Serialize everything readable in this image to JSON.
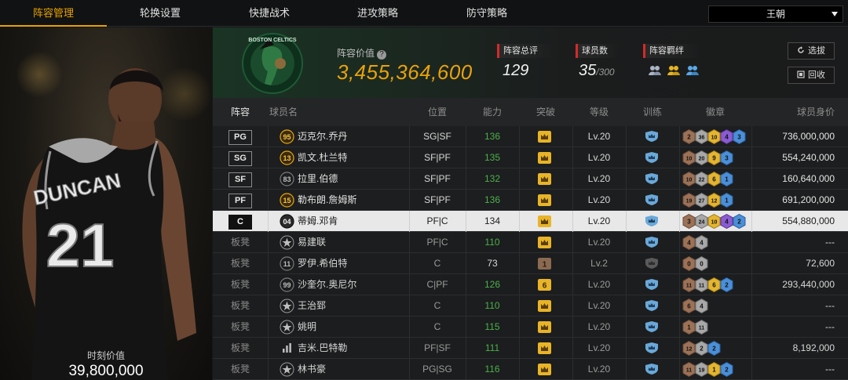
{
  "nav": {
    "tabs": [
      {
        "label": "阵容管理",
        "active": true
      },
      {
        "label": "轮换设置",
        "active": false
      },
      {
        "label": "快捷战术",
        "active": false
      },
      {
        "label": "进攻策略",
        "active": false
      },
      {
        "label": "防守策略",
        "active": false
      }
    ],
    "team_select": "王朝"
  },
  "player_panel": {
    "jersey_name": "DUNCAN",
    "jersey_number": "21",
    "value_label": "时刻价值",
    "value": "39,800,000"
  },
  "summary": {
    "team_logo_text": "BOSTON CELTICS",
    "lineup_value_label": "阵容价值",
    "lineup_value": "3,455,364,600",
    "total_rating_label": "阵容总评",
    "total_rating": "129",
    "player_count_label": "球员数",
    "player_count": "35",
    "player_count_max": "/300",
    "bond_label": "阵容羁绊",
    "select_button": "选拔",
    "recycle_button": "回收"
  },
  "colors": {
    "accent": "#e8a100",
    "potential_green": "#4bb14b",
    "value_gold": "#e8a20a",
    "tag_red": "#d42a2a"
  },
  "table": {
    "headers": {
      "lineup": "阵容",
      "name": "球员名",
      "position": "位置",
      "ability": "能力",
      "breakthrough": "突破",
      "level": "等级",
      "training": "训练",
      "badges": "徽章",
      "value": "球员身价"
    },
    "rows": [
      {
        "slot": "PG",
        "bench": false,
        "rank": "95",
        "rank_style": "gold",
        "name": "迈克尔.乔丹",
        "position": "SG|SF",
        "ability": "136",
        "ability_green": true,
        "breakthrough": "crown-gold",
        "level": "Lv.20",
        "training": "blue",
        "badges": [
          {
            "v": "2",
            "c": "bronze"
          },
          {
            "v": "36",
            "c": "silver"
          },
          {
            "v": "10",
            "c": "gold"
          },
          {
            "v": "4",
            "c": "purple"
          },
          {
            "v": "3",
            "c": "blue"
          }
        ],
        "value": "736,000,000",
        "selected": false
      },
      {
        "slot": "SG",
        "bench": false,
        "rank": "13",
        "rank_style": "gold",
        "name": "凯文.杜兰特",
        "position": "SF|PF",
        "ability": "135",
        "ability_green": true,
        "breakthrough": "crown-gold",
        "level": "Lv.20",
        "training": "blue",
        "badges": [
          {
            "v": "10",
            "c": "bronze"
          },
          {
            "v": "20",
            "c": "silver"
          },
          {
            "v": "9",
            "c": "gold"
          },
          {
            "v": "3",
            "c": "blue"
          }
        ],
        "value": "554,240,000",
        "selected": false
      },
      {
        "slot": "SF",
        "bench": false,
        "rank": "83",
        "rank_style": "plain",
        "name": "拉里.伯德",
        "position": "SF|PF",
        "ability": "132",
        "ability_green": true,
        "breakthrough": "crown-gold",
        "level": "Lv.20",
        "training": "blue",
        "badges": [
          {
            "v": "10",
            "c": "bronze"
          },
          {
            "v": "22",
            "c": "silver"
          },
          {
            "v": "6",
            "c": "gold"
          },
          {
            "v": "1",
            "c": "blue"
          }
        ],
        "value": "160,640,000",
        "selected": false
      },
      {
        "slot": "PF",
        "bench": false,
        "rank": "15",
        "rank_style": "gold",
        "name": "勒布朗.詹姆斯",
        "position": "SF|PF",
        "ability": "136",
        "ability_green": true,
        "breakthrough": "crown-gold",
        "level": "Lv.20",
        "training": "blue",
        "badges": [
          {
            "v": "19",
            "c": "bronze"
          },
          {
            "v": "27",
            "c": "silver"
          },
          {
            "v": "12",
            "c": "gold"
          },
          {
            "v": "1",
            "c": "blue"
          }
        ],
        "value": "691,200,000",
        "selected": false
      },
      {
        "slot": "C",
        "bench": false,
        "rank": "04",
        "rank_style": "dark",
        "name": "蒂姆.邓肯",
        "position": "PF|C",
        "ability": "134",
        "ability_green": false,
        "breakthrough": "crown-gold",
        "level": "Lv.20",
        "training": "blue",
        "badges": [
          {
            "v": "3",
            "c": "bronze"
          },
          {
            "v": "24",
            "c": "silver"
          },
          {
            "v": "10",
            "c": "gold"
          },
          {
            "v": "4",
            "c": "purple"
          },
          {
            "v": "2",
            "c": "blue"
          }
        ],
        "value": "554,880,000",
        "selected": true
      },
      {
        "slot": "板凳",
        "bench": true,
        "rank": "",
        "rank_style": "star",
        "name": "易建联",
        "position": "PF|C",
        "ability": "110",
        "ability_green": true,
        "breakthrough": "crown-gold",
        "level": "Lv.20",
        "training": "blue",
        "badges": [
          {
            "v": "4",
            "c": "bronze"
          },
          {
            "v": "4",
            "c": "silver"
          }
        ],
        "value": "---",
        "selected": false
      },
      {
        "slot": "板凳",
        "bench": true,
        "rank": "11",
        "rank_style": "plain",
        "name": "罗伊.希伯特",
        "position": "C",
        "ability": "73",
        "ability_green": false,
        "breakthrough": "num-1",
        "level": "Lv.2",
        "training": "grey",
        "badges": [
          {
            "v": "0",
            "c": "bronze"
          },
          {
            "v": "0",
            "c": "silver"
          }
        ],
        "value": "72,600",
        "selected": false
      },
      {
        "slot": "板凳",
        "bench": true,
        "rank": "99",
        "rank_style": "plain",
        "name": "沙奎尔.奥尼尔",
        "position": "C|PF",
        "ability": "126",
        "ability_green": true,
        "breakthrough": "num-6",
        "level": "Lv.20",
        "training": "blue",
        "badges": [
          {
            "v": "11",
            "c": "bronze"
          },
          {
            "v": "11",
            "c": "silver"
          },
          {
            "v": "6",
            "c": "gold"
          },
          {
            "v": "2",
            "c": "blue"
          }
        ],
        "value": "293,440,000",
        "selected": false
      },
      {
        "slot": "板凳",
        "bench": true,
        "rank": "",
        "rank_style": "star",
        "name": "王治郅",
        "position": "C",
        "ability": "110",
        "ability_green": true,
        "breakthrough": "crown-gold",
        "level": "Lv.20",
        "training": "blue",
        "badges": [
          {
            "v": "6",
            "c": "bronze"
          },
          {
            "v": "4",
            "c": "silver"
          }
        ],
        "value": "---",
        "selected": false
      },
      {
        "slot": "板凳",
        "bench": true,
        "rank": "",
        "rank_style": "star",
        "name": "姚明",
        "position": "C",
        "ability": "115",
        "ability_green": true,
        "breakthrough": "crown-gold",
        "level": "Lv.20",
        "training": "blue",
        "badges": [
          {
            "v": "1",
            "c": "bronze"
          },
          {
            "v": "11",
            "c": "silver"
          }
        ],
        "value": "---",
        "selected": false
      },
      {
        "slot": "板凳",
        "bench": true,
        "rank": "",
        "rank_style": "bars",
        "name": "吉米.巴特勒",
        "position": "PF|SF",
        "ability": "111",
        "ability_green": true,
        "breakthrough": "crown-gold",
        "level": "Lv.20",
        "training": "blue",
        "badges": [
          {
            "v": "12",
            "c": "bronze"
          },
          {
            "v": "2",
            "c": "silver"
          },
          {
            "v": "2",
            "c": "blue"
          }
        ],
        "value": "8,192,000",
        "selected": false
      },
      {
        "slot": "板凳",
        "bench": true,
        "rank": "",
        "rank_style": "star",
        "name": "林书豪",
        "position": "PG|SG",
        "ability": "116",
        "ability_green": true,
        "breakthrough": "crown-gold",
        "level": "Lv.20",
        "training": "blue",
        "badges": [
          {
            "v": "11",
            "c": "bronze"
          },
          {
            "v": "19",
            "c": "silver"
          },
          {
            "v": "1",
            "c": "gold"
          },
          {
            "v": "2",
            "c": "blue"
          }
        ],
        "value": "---",
        "selected": false
      }
    ]
  }
}
